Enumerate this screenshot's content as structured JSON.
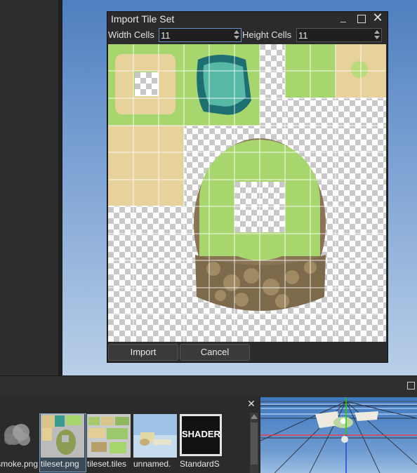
{
  "dialog": {
    "title": "Import Tile Set",
    "width_label": "Width Cells",
    "width_value": "11",
    "height_label": "Height Cells",
    "height_value": "11",
    "import_label": "Import",
    "cancel_label": "Cancel"
  },
  "assets": {
    "items": [
      {
        "label": "smoke.png"
      },
      {
        "label": "tileset.png"
      },
      {
        "label": "tileset.tiles"
      },
      {
        "label": "unnamed."
      },
      {
        "label": "StandardS"
      }
    ],
    "shader_badge": "SHADER"
  },
  "icons": [
    "minimize-icon",
    "maximize-icon",
    "close-icon",
    "spin-up-icon",
    "spin-down-icon"
  ],
  "colors": {
    "accent": "#6a8fc0",
    "grass": "#a8d66e",
    "sand": "#e6d29a",
    "water": "#3aa59a",
    "rock": "#8b7355"
  }
}
